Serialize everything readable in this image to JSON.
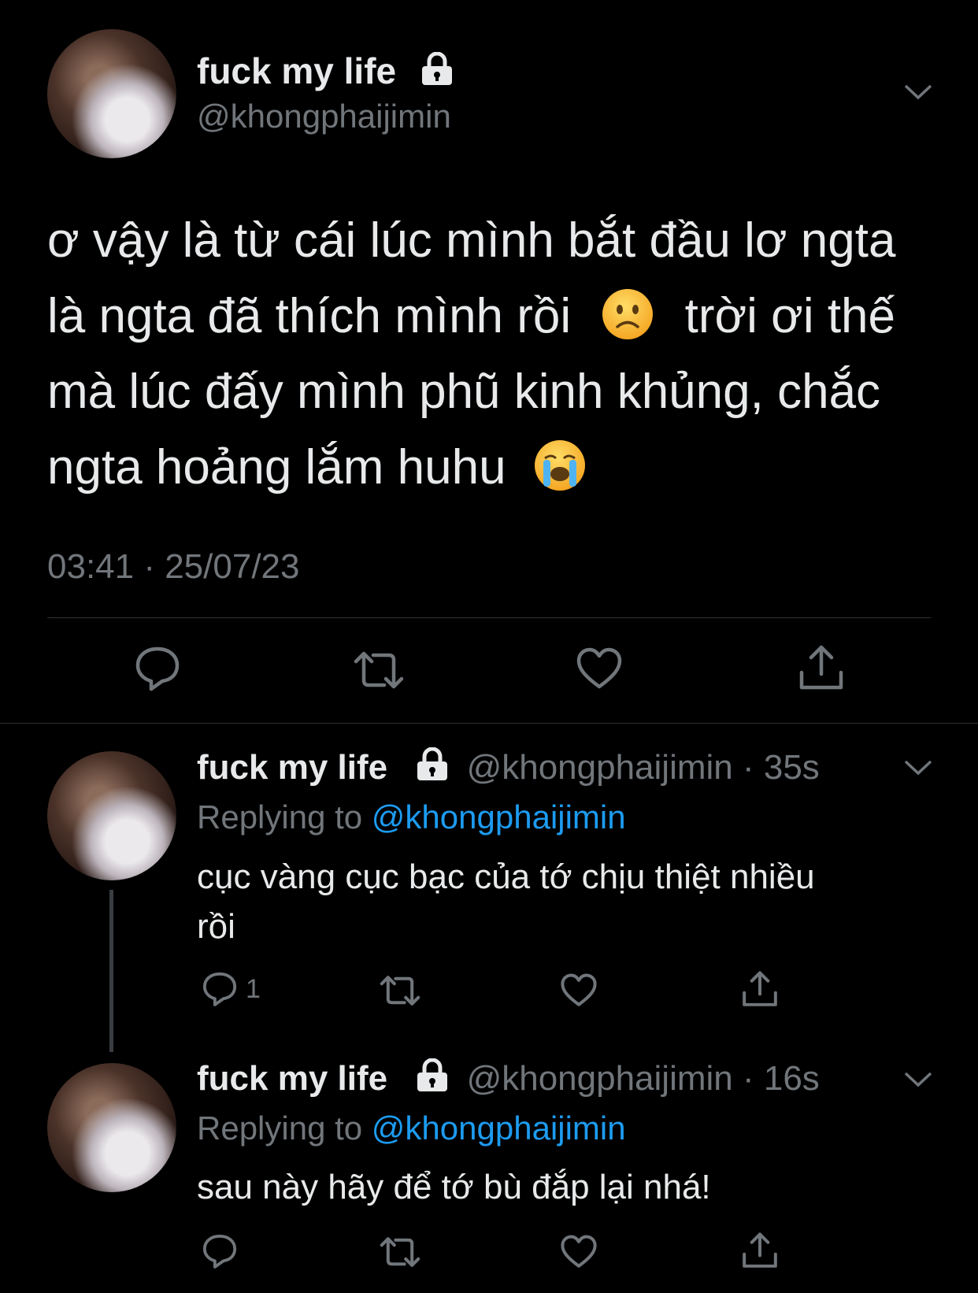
{
  "main_tweet": {
    "display_name": "fuck my life",
    "handle": "@khongphaijimin",
    "text_line1": "ơ vậy là từ cái lúc mình bắt đầu lơ ngta",
    "text_line2a": "là ngta đã thích mình rồi",
    "text_line2b": "trời ơi thế",
    "text_line3": "mà lúc đấy mình phũ kinh khủng, chắc",
    "text_line4": "ngta hoảng lắm huhu",
    "timestamp": "03:41 · 25/07/23"
  },
  "replies": [
    {
      "display_name": "fuck my life",
      "handle": "@khongphaijimin",
      "time": "· 35s",
      "replying_label": "Replying to",
      "replying_to": "@khongphaijimin",
      "text_line1": "cục vàng cục bạc của tớ chịu thiệt nhiều",
      "text_line2": "rồi",
      "reply_count": "1"
    },
    {
      "display_name": "fuck my life",
      "handle": "@khongphaijimin",
      "time": "· 16s",
      "replying_label": "Replying to",
      "replying_to": "@khongphaijimin",
      "text_line1": "sau này hãy để tớ bù đắp lại nhá!",
      "reply_count": ""
    }
  ],
  "icons": {
    "lock": "lock-icon",
    "reply": "reply-icon",
    "retweet": "retweet-icon",
    "like": "like-icon",
    "share": "share-icon",
    "more": "chevron-down-icon",
    "emoji_frown": "slightly-frowning-face",
    "emoji_cry": "loudly-crying-face"
  },
  "colors": {
    "background": "#000000",
    "text": "#e7e9ea",
    "muted": "#71767b",
    "accent": "#1d9bf0",
    "divider": "#2f3336"
  }
}
